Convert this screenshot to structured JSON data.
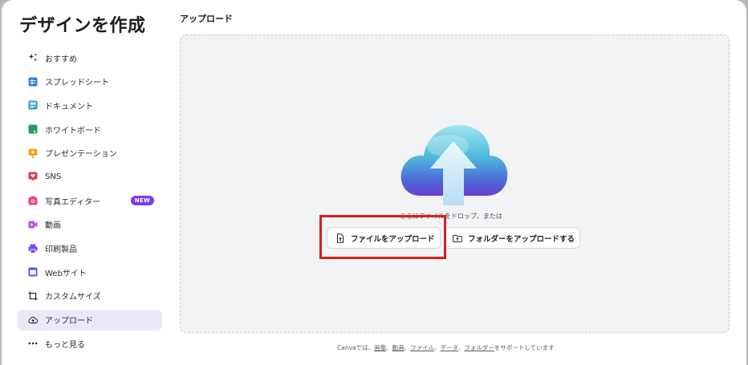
{
  "dialog": {
    "title": "デザインを作成"
  },
  "sidebar": {
    "items": [
      {
        "label": "おすすめ",
        "icon": "sparkle-icon",
        "color": "#2b2b2f"
      },
      {
        "label": "スプレッドシート",
        "icon": "spreadsheet-icon",
        "color": "#2f7ce0"
      },
      {
        "label": "ドキュメント",
        "icon": "document-icon",
        "color": "#2a9fbf"
      },
      {
        "label": "ホワイトボード",
        "icon": "whiteboard-icon",
        "color": "#1f9e5c"
      },
      {
        "label": "プレゼンテーション",
        "icon": "presentation-icon",
        "color": "#f0a21e"
      },
      {
        "label": "SNS",
        "icon": "heart-icon",
        "color": "#e8334a"
      },
      {
        "label": "写真エディター",
        "icon": "camera-icon",
        "color": "#ea3f86",
        "badge": "NEW"
      },
      {
        "label": "動画",
        "icon": "video-icon",
        "color": "#b455e6"
      },
      {
        "label": "印刷製品",
        "icon": "printer-icon",
        "color": "#7a4cf0"
      },
      {
        "label": "Webサイト",
        "icon": "website-icon",
        "color": "#4b57e8"
      },
      {
        "label": "カスタムサイズ",
        "icon": "crop-icon",
        "color": "#2b2b2f"
      },
      {
        "label": "アップロード",
        "icon": "cloud-upload-icon",
        "color": "#2b2b2f",
        "active": true
      },
      {
        "label": "もっと見る",
        "icon": "more-icon",
        "color": "#2b2b2f"
      }
    ]
  },
  "main": {
    "section_title": "アップロード",
    "drop_text": "ここにファイルをドロップ、または",
    "upload_file_label": "ファイルをアップロード",
    "upload_folder_label": "フォルダーをアップロードする",
    "footer": {
      "prefix": "Canvaでは、",
      "image": "画像",
      "sep1": "、",
      "video": "動画",
      "sep2": "、",
      "file": "ファイル",
      "sep3": "、",
      "data": "データ",
      "sep4": "、",
      "folder": "フォルダー",
      "suffix": "をサポートしています"
    }
  },
  "colors": {
    "accent": "#7d3cf0",
    "active_bg": "#ece8f8",
    "highlight_border": "#d61f1f"
  }
}
